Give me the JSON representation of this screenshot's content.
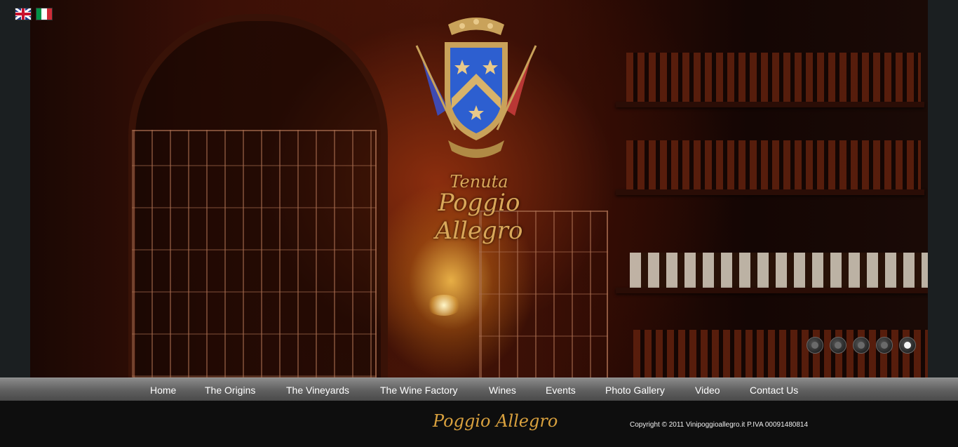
{
  "languages": [
    {
      "code": "en",
      "flag": "uk-flag-icon"
    },
    {
      "code": "it",
      "flag": "italy-flag-icon"
    }
  ],
  "hero": {
    "brand_line1": "Tenuta",
    "brand_line2": "Poggio Allegro",
    "crest": "coat-of-arms-icon",
    "slides": {
      "count": 5,
      "active_index": 4
    }
  },
  "nav": {
    "items": [
      {
        "label": "Home"
      },
      {
        "label": "The Origins"
      },
      {
        "label": "The Vineyards"
      },
      {
        "label": "The Wine Factory"
      },
      {
        "label": "Wines"
      },
      {
        "label": "Events"
      },
      {
        "label": "Photo Gallery"
      },
      {
        "label": "Video"
      },
      {
        "label": "Contact Us"
      }
    ]
  },
  "footer": {
    "brand": "Poggio Allegro",
    "copyright": "Copyright © 2011 Vinipoggioallegro.it P.IVA 00091480814"
  },
  "colors": {
    "accent_gold": "#d9a13e",
    "nav_bg": "#6a6a6a",
    "footer_bg": "#0e0e0e"
  }
}
